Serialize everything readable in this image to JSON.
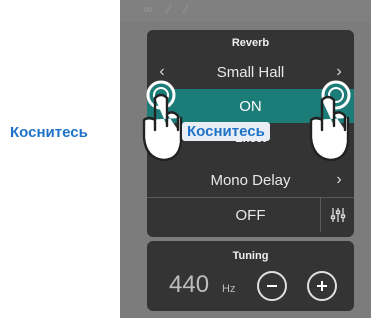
{
  "reverb": {
    "title": "Reverb",
    "type": "Small Hall",
    "state": "ON"
  },
  "effect": {
    "title": "Effect",
    "type": "Mono Delay",
    "state": "OFF"
  },
  "tuning": {
    "title": "Tuning",
    "value": "440",
    "unit": "Hz"
  },
  "touch_labels": [
    "Коснитесь",
    "Коснитесь"
  ],
  "colors": {
    "accent": "#1b7c78",
    "label": "#1e73c8",
    "panel": "#343434"
  }
}
